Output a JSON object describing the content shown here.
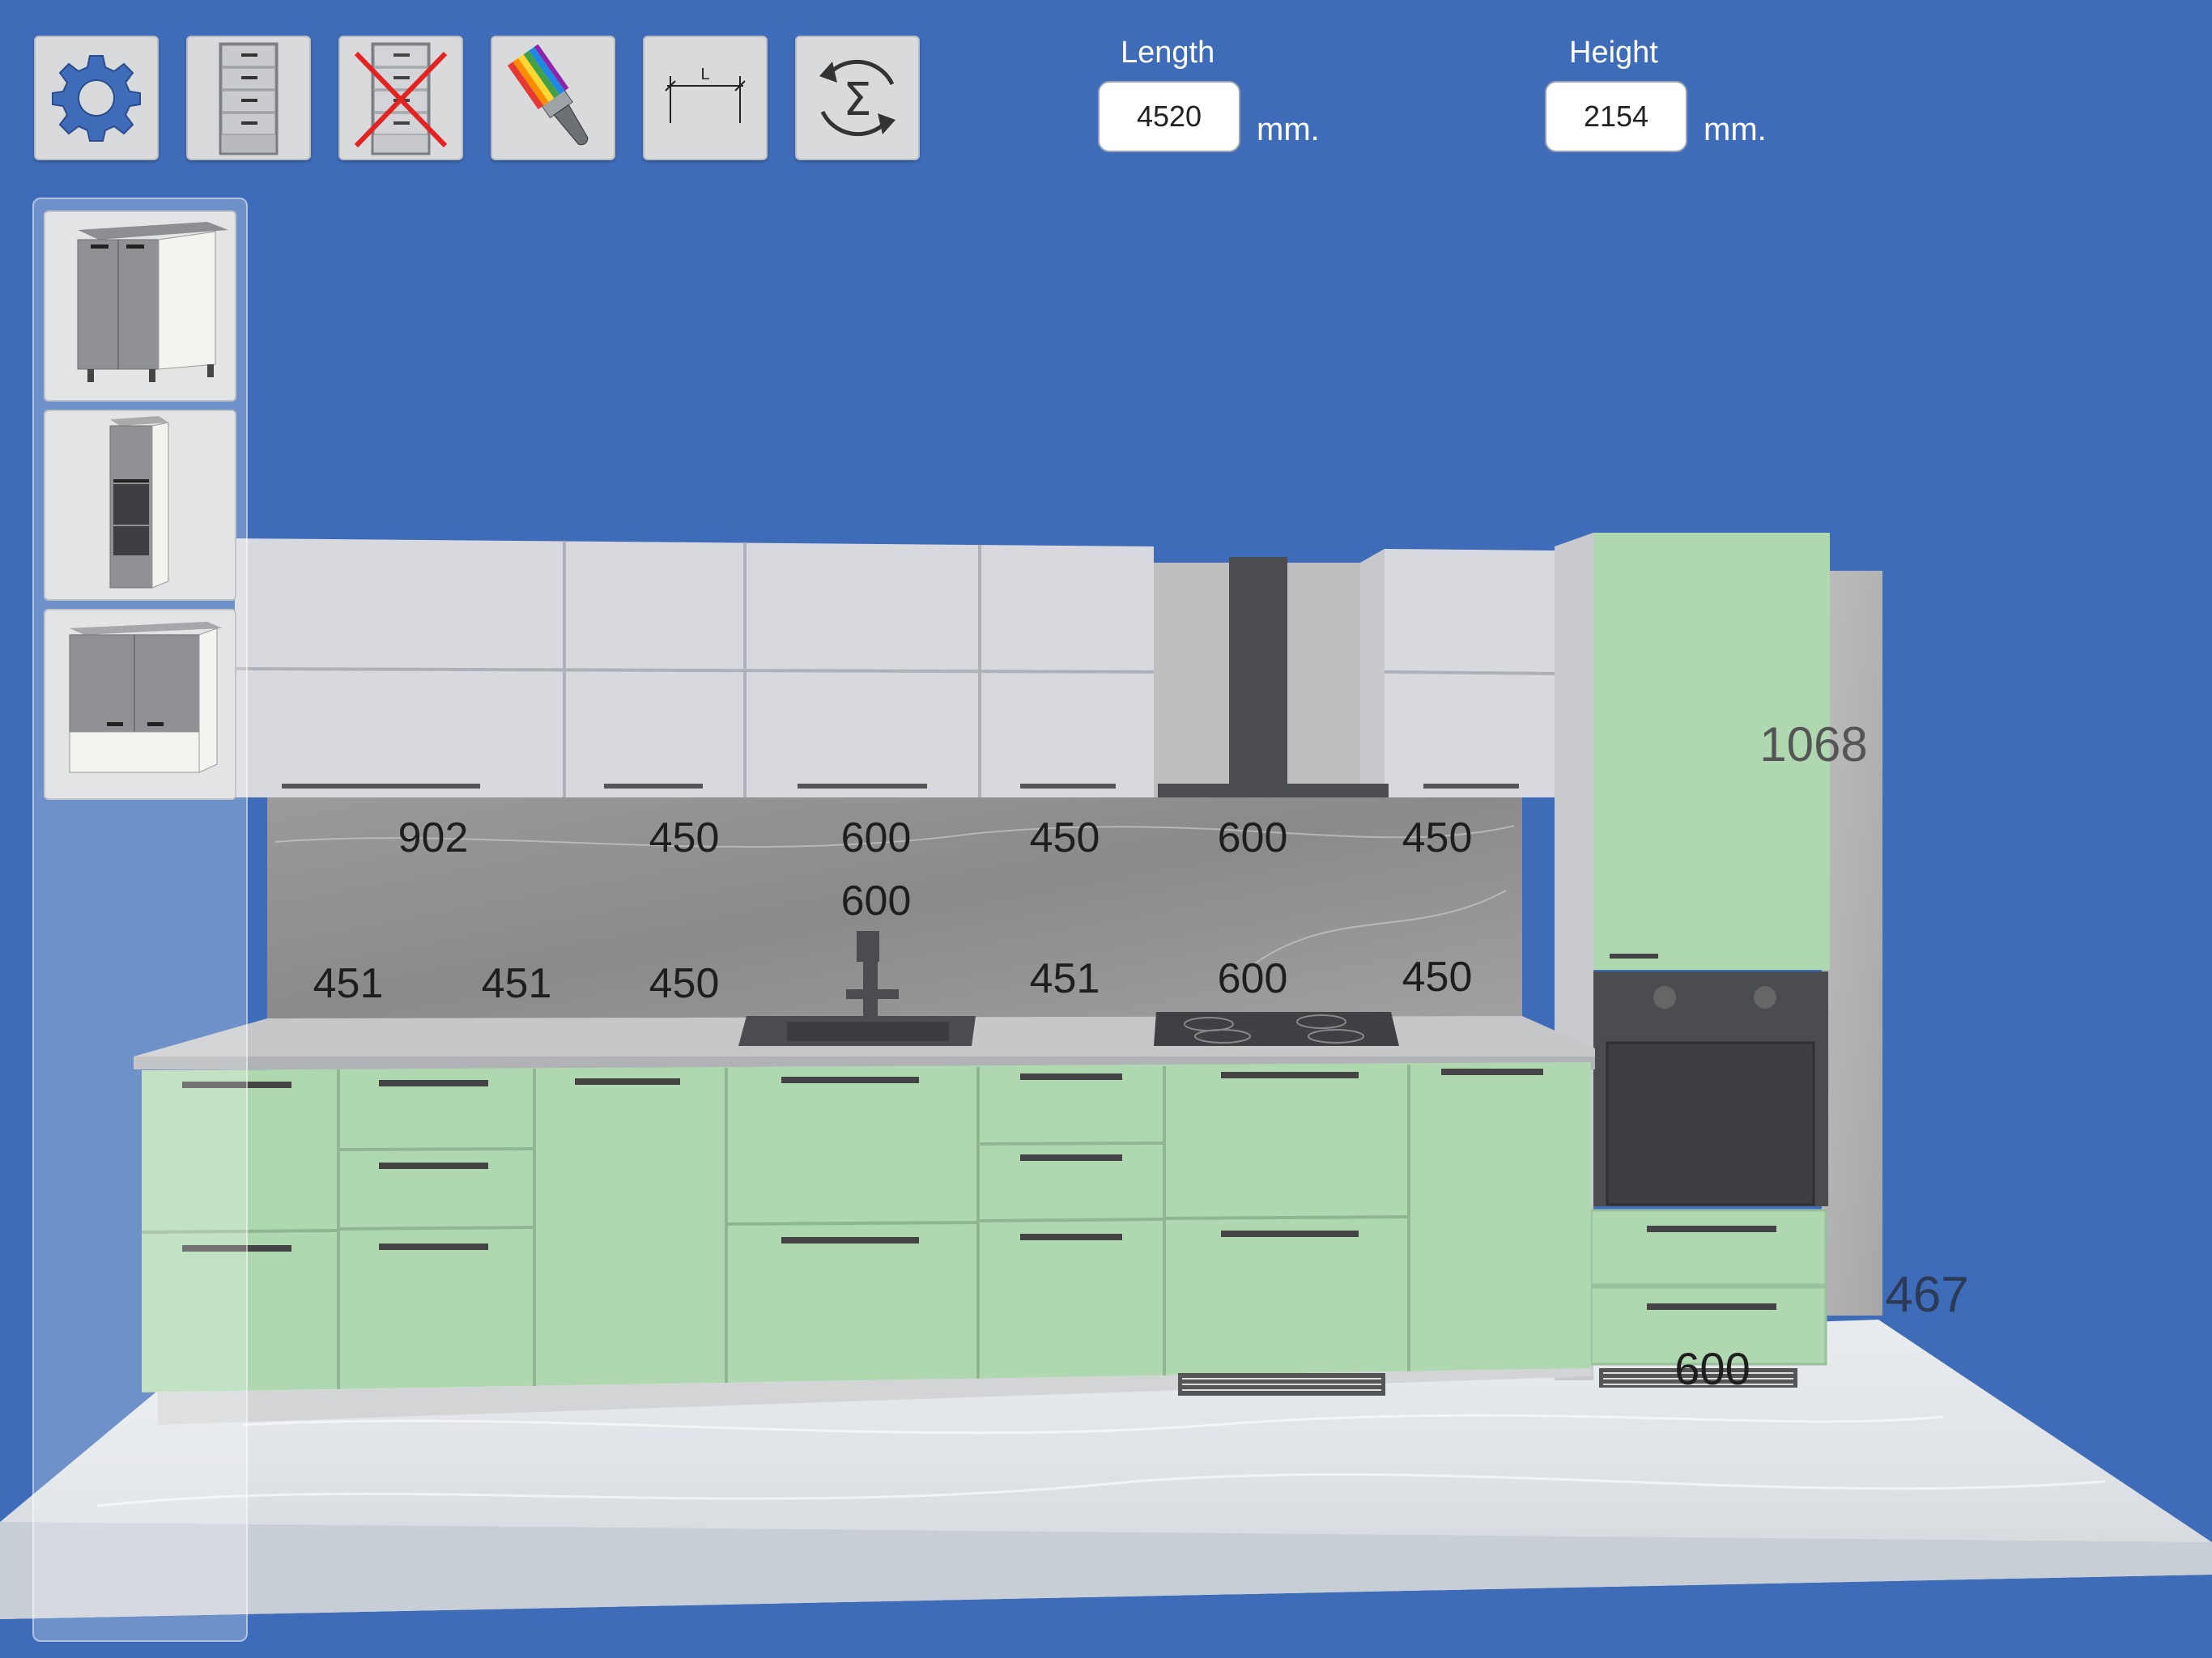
{
  "toolbar": {
    "buttons": [
      {
        "name": "settings-button",
        "icon": "gear-icon"
      },
      {
        "name": "drawer-cabinet-button",
        "icon": "drawer-cabinet-icon"
      },
      {
        "name": "delete-cabinet-button",
        "icon": "delete-cabinet-icon"
      },
      {
        "name": "paint-brush-button",
        "icon": "paint-brush-icon"
      },
      {
        "name": "dimension-button",
        "icon": "dimension-ruler-icon",
        "label": "L"
      },
      {
        "name": "calculate-sum-button",
        "icon": "sigma-refresh-icon"
      }
    ]
  },
  "dimensions": {
    "length": {
      "label": "Length",
      "value": "4520",
      "unit": "mm."
    },
    "height": {
      "label": "Height",
      "value": "2154",
      "unit": "mm."
    }
  },
  "catalog": {
    "items": [
      {
        "name": "base-cabinet-thumb",
        "icon": "base-cabinet-icon"
      },
      {
        "name": "tall-oven-cabinet-thumb",
        "icon": "tall-cabinet-icon"
      },
      {
        "name": "wall-cabinet-thumb",
        "icon": "wall-cabinet-open-shelf-icon"
      }
    ]
  },
  "scene": {
    "upper_widths": [
      "902",
      "450",
      "600",
      "450",
      "600",
      "450"
    ],
    "middle_label": "600",
    "lower_widths": [
      "451",
      "451",
      "450",
      "451",
      "600",
      "450"
    ],
    "tall_upper_height": "1068",
    "tall_side_depth": "467",
    "tall_width": "600",
    "colors": {
      "background": "#3f6cb9",
      "fronts": "#afd8b1",
      "upper_fronts": "#d7d9de",
      "backsplash": "#8f8f8f",
      "countertop": "#c6c7c9",
      "appliances": "#4a4c50"
    }
  }
}
